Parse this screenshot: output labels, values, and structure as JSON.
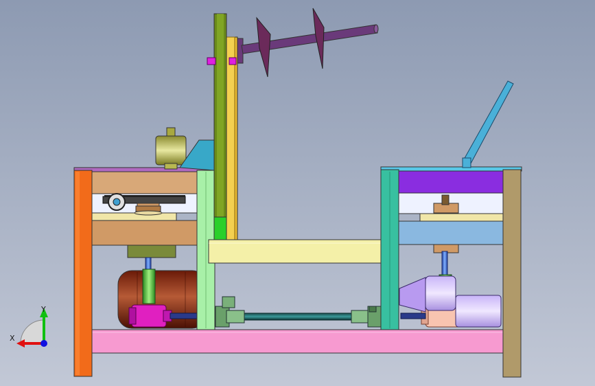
{
  "viewport": {
    "background_top": "#8d9ab2",
    "background_bottom": "#c2c8d6"
  },
  "triad": {
    "x_label": "X",
    "y_label": "Y",
    "x_color": "#e01010",
    "y_color": "#10c010",
    "z_color": "#1010e0"
  },
  "colors": {
    "left_leg": "#f26b1a",
    "right_leg": "#b09a6a",
    "base_rail": "#f79ad0",
    "copper_slab": "#d09a66",
    "lavender_bar": "#f4f0a8",
    "green_frame": "#a8f0a8",
    "teal_frame": "#38c0a0",
    "purple_plate": "#8a2de0",
    "blue_slab": "#8ab8e0",
    "blade_pair": "#6b2a5a",
    "shaft": "#6a3a7a",
    "olive_blade": "#7a8a1a",
    "motor": "#8a2a10",
    "cyan_lever": "#4ab0d8"
  }
}
